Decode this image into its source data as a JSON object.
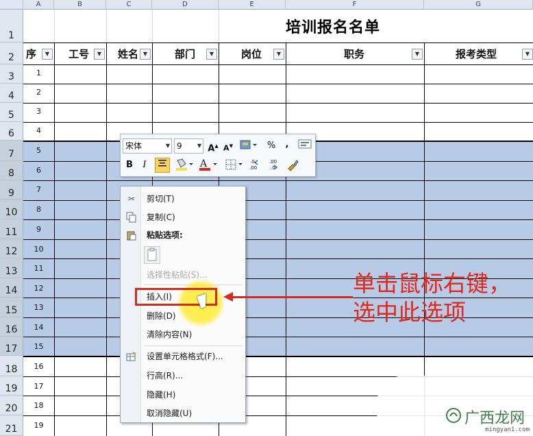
{
  "columns": [
    "A",
    "B",
    "C",
    "D",
    "E",
    "F",
    "G"
  ],
  "rows": [
    "1",
    "2",
    "3",
    "4",
    "5",
    "6",
    "7",
    "8",
    "9",
    "10",
    "11",
    "12",
    "13",
    "14",
    "15",
    "16",
    "17",
    "18",
    "19",
    "20",
    "21"
  ],
  "sheet": {
    "title": "培训报名名单",
    "headers": {
      "seq": "序",
      "id": "工号",
      "name": "姓名",
      "dept": "部门",
      "post": "岗位",
      "role": "职务",
      "exam_type": "报考类型"
    },
    "seq_numbers": [
      "1",
      "2",
      "3",
      "4",
      "5",
      "6",
      "7",
      "8",
      "9",
      "10",
      "11",
      "12",
      "13",
      "14",
      "15",
      "16",
      "17",
      "18",
      "19"
    ]
  },
  "mini_toolbar": {
    "font_name": "宋体",
    "font_size": "9",
    "percent": "%",
    "comma": ","
  },
  "context_menu": {
    "items": [
      {
        "label": "剪切(T)",
        "icon": "scissors-icon",
        "enabled": true
      },
      {
        "label": "复制(C)",
        "icon": "copy-icon",
        "enabled": true
      },
      {
        "label": "粘贴选项:",
        "icon": "paste-icon",
        "enabled": true,
        "bold": true
      },
      {
        "label": "选择性粘贴(S)...",
        "enabled": false
      },
      {
        "label": "插入(I)",
        "enabled": true,
        "highlighted": true
      },
      {
        "label": "删除(D)",
        "enabled": true
      },
      {
        "label": "清除内容(N)",
        "enabled": true
      },
      {
        "label": "设置单元格格式(F)...",
        "icon": "format-cells-icon",
        "enabled": true
      },
      {
        "label": "行高(R)...",
        "enabled": true
      },
      {
        "label": "隐藏(H)",
        "enabled": true
      },
      {
        "label": "取消隐藏(U)",
        "enabled": true
      }
    ]
  },
  "annotation": {
    "line1": "单击鼠标右键，",
    "line2": "选中此选项"
  },
  "watermark": {
    "text": "广西龙网",
    "url": "mingyan1.com"
  },
  "colors": {
    "selection": "#b7cbe6",
    "annotation": "#e0281d",
    "highlight": "#ffec3c"
  }
}
